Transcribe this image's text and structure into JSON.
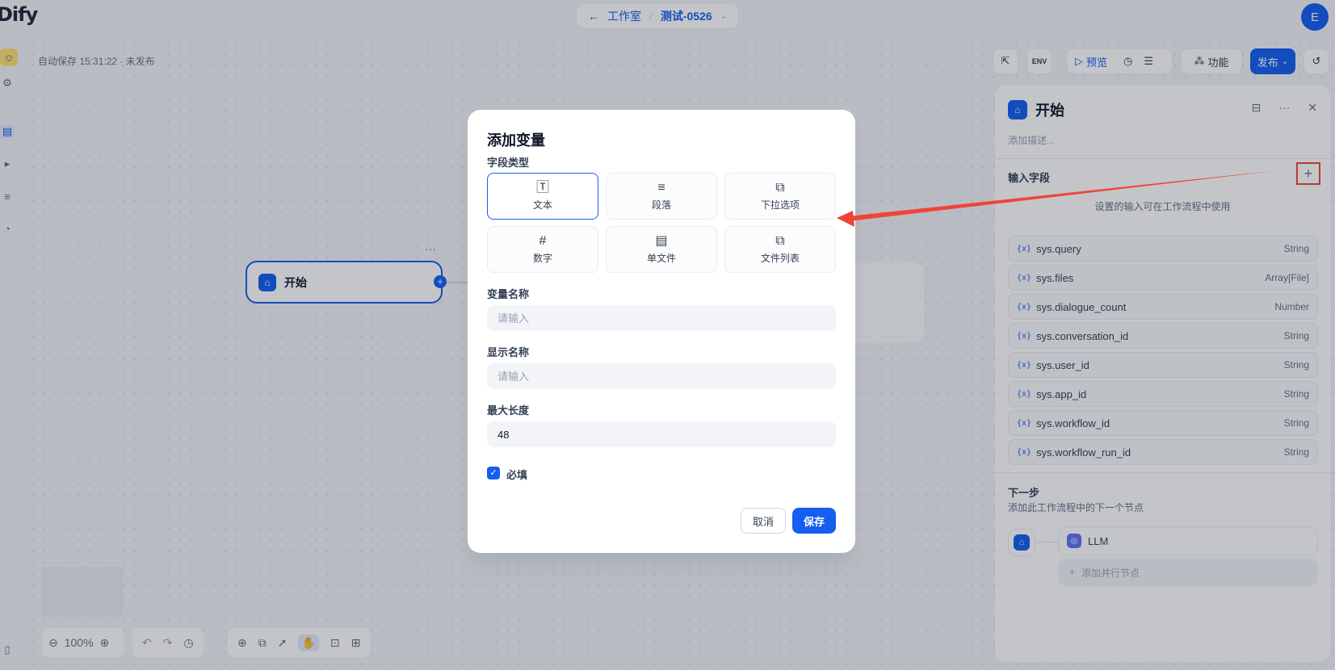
{
  "header": {
    "logo": "Dify",
    "breadcrumb_workspace": "工作室",
    "breadcrumb_project": "测试-0526",
    "avatar_letter": "E"
  },
  "canvas": {
    "autosave": "自动保存 15:31:22 · 未发布",
    "start_node_label": "开始",
    "zoom": "100%"
  },
  "toolbar": {
    "env_label": "ENV",
    "preview_label": "预览",
    "features_label": "功能",
    "publish_label": "发布"
  },
  "panel": {
    "title": "开始",
    "description_placeholder": "添加描述...",
    "input_fields_title": "输入字段",
    "hint": "设置的输入可在工作流程中使用",
    "variables": [
      {
        "name": "sys.query",
        "type": "String"
      },
      {
        "name": "sys.files",
        "type": "Array[File]"
      },
      {
        "name": "sys.dialogue_count",
        "type": "Number"
      },
      {
        "name": "sys.conversation_id",
        "type": "String"
      },
      {
        "name": "sys.user_id",
        "type": "String"
      },
      {
        "name": "sys.app_id",
        "type": "String"
      },
      {
        "name": "sys.workflow_id",
        "type": "String"
      },
      {
        "name": "sys.workflow_run_id",
        "type": "String"
      }
    ],
    "var_prefix": "{x}",
    "next_title": "下一步",
    "next_desc": "添加此工作流程中的下一个节点",
    "next_node": "LLM",
    "add_parallel": "添加并行节点"
  },
  "modal": {
    "title": "添加变量",
    "field_type_label": "字段类型",
    "types": [
      {
        "label": "文本",
        "icon": "text-type-icon",
        "selected": true
      },
      {
        "label": "段落",
        "icon": "paragraph-icon",
        "selected": false
      },
      {
        "label": "下拉选项",
        "icon": "select-icon",
        "selected": false
      },
      {
        "label": "数字",
        "icon": "number-icon",
        "selected": false
      },
      {
        "label": "单文件",
        "icon": "single-file-icon",
        "selected": false
      },
      {
        "label": "文件列表",
        "icon": "file-list-icon",
        "selected": false
      }
    ],
    "var_name_label": "变量名称",
    "var_name_placeholder": "请输入",
    "display_name_label": "显示名称",
    "display_name_placeholder": "请输入",
    "max_length_label": "最大长度",
    "max_length_value": "48",
    "required_label": "必填",
    "required_checked": true,
    "cancel_label": "取消",
    "save_label": "保存"
  },
  "colors": {
    "accent": "#155eef",
    "annotation": "#f04438"
  }
}
